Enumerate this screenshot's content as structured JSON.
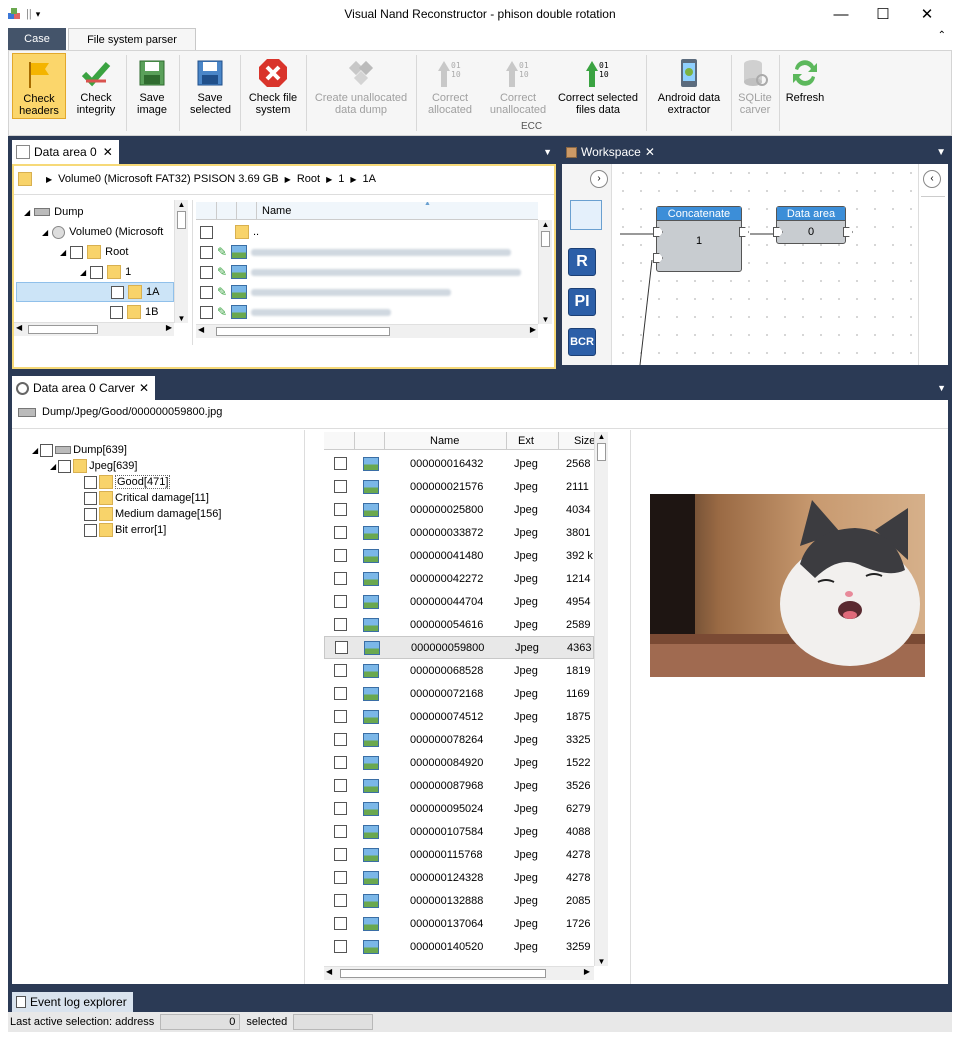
{
  "window": {
    "title": "Visual Nand Reconstructor - phison double rotation"
  },
  "ribbon": {
    "tabs": [
      {
        "label": "Case"
      },
      {
        "label": "File system parser"
      }
    ],
    "buttons": {
      "check_headers": "Check headers",
      "check_integrity": "Check integrity",
      "save_image": "Save image",
      "save_selected": "Save selected",
      "check_file_system": "Check file system",
      "create_unallocated": "Create unallocated data dump",
      "correct_allocated": "Correct allocated",
      "correct_unallocated": "Correct unallocated",
      "correct_selected_files": "Correct selected files data",
      "android_extractor": "Android data extractor",
      "sqlite_carver": "SQLite carver",
      "refresh": "Refresh"
    },
    "ecc_label": "ECC"
  },
  "data_area": {
    "tab_label": "Data area 0",
    "breadcrumb": [
      "Volume0 (Microsoft FAT32) PSISON  3.69 GB",
      "Root",
      "1",
      "1A"
    ],
    "tree": [
      "Dump",
      "Volume0 (Microsoft",
      "Root",
      "1",
      "1A",
      "1B"
    ],
    "column_name": "Name",
    "up_item": ".."
  },
  "workspace": {
    "tab_label": "Workspace",
    "node_concatenate": {
      "title": "Concatenate",
      "value": "1"
    },
    "node_data_area": {
      "title": "Data area",
      "value": "0"
    },
    "side_buttons": [
      "R",
      "PI",
      "BCR"
    ]
  },
  "carver": {
    "tab_label": "Data area 0 Carver",
    "path": "Dump/Jpeg/Good/000000059800.jpg",
    "tree": [
      "Dump[639]",
      "Jpeg[639]",
      "Good[471]",
      "Critical damage[11]",
      "Medium damage[156]",
      "Bit error[1]"
    ],
    "columns": {
      "name": "Name",
      "ext": "Ext",
      "size": "Size"
    },
    "rows": [
      {
        "name": "000000016432",
        "ext": "Jpeg",
        "size": "2568"
      },
      {
        "name": "000000021576",
        "ext": "Jpeg",
        "size": "2111"
      },
      {
        "name": "000000025800",
        "ext": "Jpeg",
        "size": "4034"
      },
      {
        "name": "000000033872",
        "ext": "Jpeg",
        "size": "3801"
      },
      {
        "name": "000000041480",
        "ext": "Jpeg",
        "size": "392 k"
      },
      {
        "name": "000000042272",
        "ext": "Jpeg",
        "size": "1214"
      },
      {
        "name": "000000044704",
        "ext": "Jpeg",
        "size": "4954"
      },
      {
        "name": "000000054616",
        "ext": "Jpeg",
        "size": "2589"
      },
      {
        "name": "000000059800",
        "ext": "Jpeg",
        "size": "4363"
      },
      {
        "name": "000000068528",
        "ext": "Jpeg",
        "size": "1819"
      },
      {
        "name": "000000072168",
        "ext": "Jpeg",
        "size": "1169"
      },
      {
        "name": "000000074512",
        "ext": "Jpeg",
        "size": "1875"
      },
      {
        "name": "000000078264",
        "ext": "Jpeg",
        "size": "3325"
      },
      {
        "name": "000000084920",
        "ext": "Jpeg",
        "size": "1522"
      },
      {
        "name": "000000087968",
        "ext": "Jpeg",
        "size": "3526"
      },
      {
        "name": "000000095024",
        "ext": "Jpeg",
        "size": "6279"
      },
      {
        "name": "000000107584",
        "ext": "Jpeg",
        "size": "4088"
      },
      {
        "name": "000000115768",
        "ext": "Jpeg",
        "size": "4278"
      },
      {
        "name": "000000124328",
        "ext": "Jpeg",
        "size": "4278"
      },
      {
        "name": "000000132888",
        "ext": "Jpeg",
        "size": "2085"
      },
      {
        "name": "000000137064",
        "ext": "Jpeg",
        "size": "1726"
      },
      {
        "name": "000000140520",
        "ext": "Jpeg",
        "size": "3259"
      }
    ]
  },
  "event_log": {
    "tab_label": "Event log explorer"
  },
  "statusbar": {
    "label": "Last active selection:  address",
    "address_value": "0",
    "selected_label": "selected"
  }
}
